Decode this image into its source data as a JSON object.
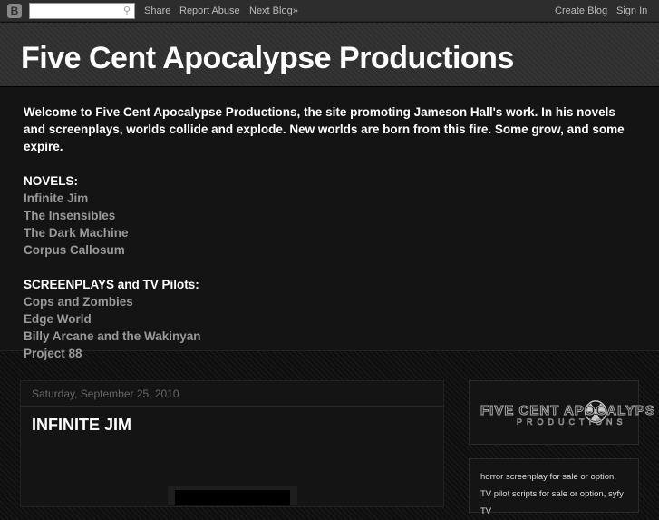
{
  "navbar": {
    "logo": "B",
    "search_placeholder": "",
    "search_icon": "magnifier-icon",
    "share": "Share",
    "report_abuse": "Report Abuse",
    "next_blog": "Next Blog»",
    "create_blog": "Create Blog",
    "sign_in": "Sign In"
  },
  "header": {
    "title": "Five Cent Apocalypse Productions"
  },
  "description": {
    "intro": "Welcome to Five Cent Apocalypse Productions, the site promoting Jameson Hall's work. In his novels and screenplays, worlds collide and explode. New worlds are born from this fire. Some grow, and some expire.",
    "novels_heading": "NOVELS:",
    "novels": [
      "Infinite Jim",
      "The Insensibles",
      "The Dark Machine",
      "Corpus Callosum"
    ],
    "screenplays_heading": "SCREENPLAYS and TV Pilots:",
    "screenplays": [
      "Cops and Zombies",
      "Edge World",
      "Billy Arcane and the Wakinyan",
      "Project 88"
    ]
  },
  "post": {
    "date": "Saturday, September 25, 2010",
    "title": "INFINITE JIM"
  },
  "sidebar": {
    "logo_line1": "FIVE CENT APOCALYPS",
    "logo_line2": "PRODUCTIONS",
    "text": "horror screenplay for sale or option, TV pilot scripts for sale or option, syfy TV"
  }
}
